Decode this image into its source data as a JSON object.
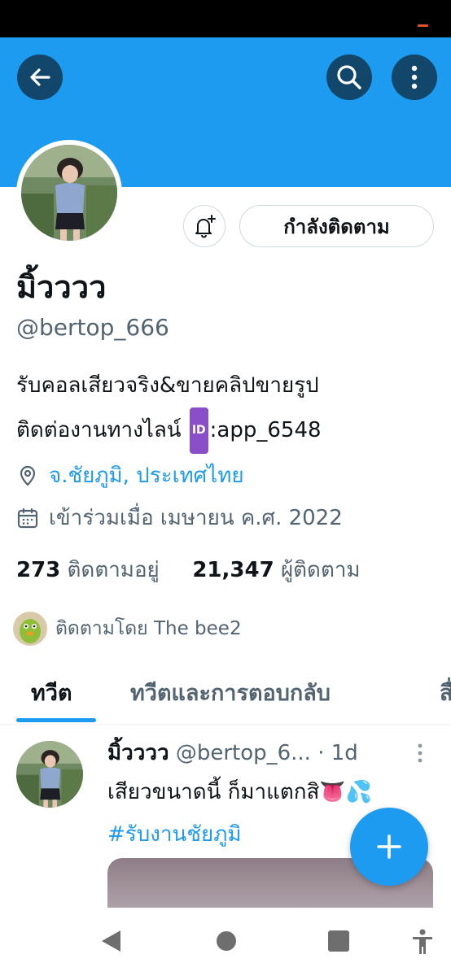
{
  "profile": {
    "display_name": "มิ้วววว",
    "handle": "@bertop_666",
    "bio_line1": "รับคอลเสียวจริง&ขายคลิปขายรูป",
    "bio_line2_prefix": "ติดต่องานทางไลน์ ",
    "bio_badge": "ID",
    "bio_line2_suffix": ":app_6548",
    "location": "จ.ชัยภูมิ, ประเทศไทย",
    "joined": "เข้าร่วมเมื่อ เมษายน ค.ศ. 2022",
    "following_count": "273",
    "following_label": "ติดตามอยู่",
    "followers_count": "21,347",
    "followers_label": "ผู้ติดตาม",
    "followed_by": "ติดตามโดย The bee2"
  },
  "actions": {
    "following_button": "กำลังติดตาม"
  },
  "tabs": [
    {
      "label": "ทวีต",
      "active": true
    },
    {
      "label": "ทวีตและการตอบกลับ",
      "active": false
    },
    {
      "label": "สื่",
      "active": false
    }
  ],
  "tweet": {
    "name": "มิ้วววว",
    "handle": "@bertop_6...",
    "time": "· 1d",
    "text": "เสียวขนาดนี้ ก็มาแตกสิ👅💦",
    "hashtag": "#รับงานชัยภูมิ"
  },
  "icons": {
    "back": "arrow-left-icon",
    "search": "search-icon",
    "more": "more-vertical-icon",
    "bell": "bell-plus-icon",
    "location": "location-pin-icon",
    "calendar": "calendar-icon",
    "compose": "plus-icon"
  },
  "colors": {
    "accent": "#1d9bf0",
    "banner": "#1d9bf0",
    "header_buttons": "#12466b",
    "text_primary": "#0f1419",
    "text_secondary": "#536471"
  }
}
